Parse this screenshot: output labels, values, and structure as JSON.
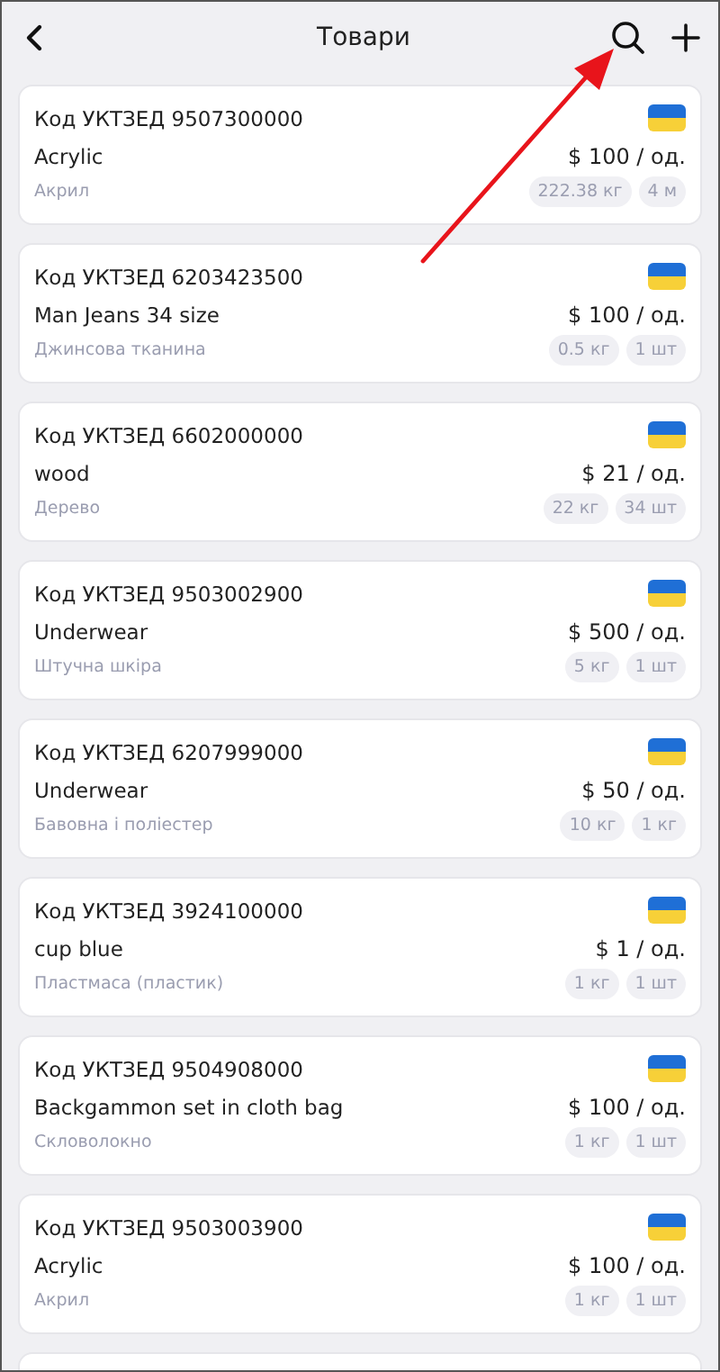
{
  "header": {
    "title": "Товари"
  },
  "products": [
    {
      "code": "Код УКТЗЕД 9507300000",
      "name": "Acrylic",
      "material": "Акрил",
      "price": "$ 100 / од.",
      "chips": [
        "222.38 кг",
        "4 м"
      ]
    },
    {
      "code": "Код УКТЗЕД 6203423500",
      "name": "Man Jeans 34 size",
      "material": "Джинсова тканина",
      "price": "$ 100 / од.",
      "chips": [
        "0.5 кг",
        "1 шт"
      ]
    },
    {
      "code": "Код УКТЗЕД 6602000000",
      "name": "wood",
      "material": "Дерево",
      "price": "$ 21 / од.",
      "chips": [
        "22 кг",
        "34 шт"
      ]
    },
    {
      "code": "Код УКТЗЕД 9503002900",
      "name": "Underwear",
      "material": "Штучна шкіра",
      "price": "$ 500 / од.",
      "chips": [
        "5 кг",
        "1 шт"
      ]
    },
    {
      "code": "Код УКТЗЕД 6207999000",
      "name": "Underwear",
      "material": "Бавовна і поліестер",
      "price": "$ 50 / од.",
      "chips": [
        "10 кг",
        "1 кг"
      ]
    },
    {
      "code": "Код УКТЗЕД 3924100000",
      "name": "cup blue",
      "material": "Пластмаса (пластик)",
      "price": "$ 1 / од.",
      "chips": [
        "1 кг",
        "1 шт"
      ]
    },
    {
      "code": "Код УКТЗЕД 9504908000",
      "name": "Backgammon set in cloth bag",
      "material": "Скловолокно",
      "price": "$ 100 / од.",
      "chips": [
        "1 кг",
        "1 шт"
      ]
    },
    {
      "code": "Код УКТЗЕД 9503003900",
      "name": "Acrylic",
      "material": "Акрил",
      "price": "$ 100 / од.",
      "chips": [
        "1 кг",
        "1 шт"
      ]
    }
  ],
  "more_below": true,
  "annotation": {
    "kind": "arrow"
  }
}
